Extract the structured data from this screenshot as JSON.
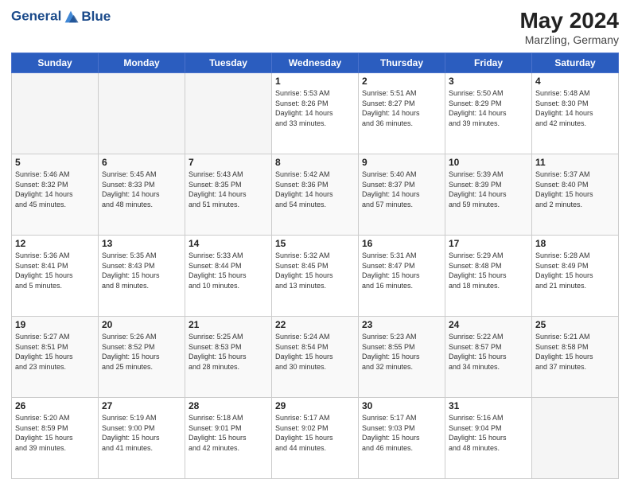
{
  "header": {
    "logo_line1": "General",
    "logo_line2": "Blue",
    "month_year": "May 2024",
    "location": "Marzling, Germany"
  },
  "weekdays": [
    "Sunday",
    "Monday",
    "Tuesday",
    "Wednesday",
    "Thursday",
    "Friday",
    "Saturday"
  ],
  "weeks": [
    [
      {
        "day": "",
        "info": ""
      },
      {
        "day": "",
        "info": ""
      },
      {
        "day": "",
        "info": ""
      },
      {
        "day": "1",
        "info": "Sunrise: 5:53 AM\nSunset: 8:26 PM\nDaylight: 14 hours\nand 33 minutes."
      },
      {
        "day": "2",
        "info": "Sunrise: 5:51 AM\nSunset: 8:27 PM\nDaylight: 14 hours\nand 36 minutes."
      },
      {
        "day": "3",
        "info": "Sunrise: 5:50 AM\nSunset: 8:29 PM\nDaylight: 14 hours\nand 39 minutes."
      },
      {
        "day": "4",
        "info": "Sunrise: 5:48 AM\nSunset: 8:30 PM\nDaylight: 14 hours\nand 42 minutes."
      }
    ],
    [
      {
        "day": "5",
        "info": "Sunrise: 5:46 AM\nSunset: 8:32 PM\nDaylight: 14 hours\nand 45 minutes."
      },
      {
        "day": "6",
        "info": "Sunrise: 5:45 AM\nSunset: 8:33 PM\nDaylight: 14 hours\nand 48 minutes."
      },
      {
        "day": "7",
        "info": "Sunrise: 5:43 AM\nSunset: 8:35 PM\nDaylight: 14 hours\nand 51 minutes."
      },
      {
        "day": "8",
        "info": "Sunrise: 5:42 AM\nSunset: 8:36 PM\nDaylight: 14 hours\nand 54 minutes."
      },
      {
        "day": "9",
        "info": "Sunrise: 5:40 AM\nSunset: 8:37 PM\nDaylight: 14 hours\nand 57 minutes."
      },
      {
        "day": "10",
        "info": "Sunrise: 5:39 AM\nSunset: 8:39 PM\nDaylight: 14 hours\nand 59 minutes."
      },
      {
        "day": "11",
        "info": "Sunrise: 5:37 AM\nSunset: 8:40 PM\nDaylight: 15 hours\nand 2 minutes."
      }
    ],
    [
      {
        "day": "12",
        "info": "Sunrise: 5:36 AM\nSunset: 8:41 PM\nDaylight: 15 hours\nand 5 minutes."
      },
      {
        "day": "13",
        "info": "Sunrise: 5:35 AM\nSunset: 8:43 PM\nDaylight: 15 hours\nand 8 minutes."
      },
      {
        "day": "14",
        "info": "Sunrise: 5:33 AM\nSunset: 8:44 PM\nDaylight: 15 hours\nand 10 minutes."
      },
      {
        "day": "15",
        "info": "Sunrise: 5:32 AM\nSunset: 8:45 PM\nDaylight: 15 hours\nand 13 minutes."
      },
      {
        "day": "16",
        "info": "Sunrise: 5:31 AM\nSunset: 8:47 PM\nDaylight: 15 hours\nand 16 minutes."
      },
      {
        "day": "17",
        "info": "Sunrise: 5:29 AM\nSunset: 8:48 PM\nDaylight: 15 hours\nand 18 minutes."
      },
      {
        "day": "18",
        "info": "Sunrise: 5:28 AM\nSunset: 8:49 PM\nDaylight: 15 hours\nand 21 minutes."
      }
    ],
    [
      {
        "day": "19",
        "info": "Sunrise: 5:27 AM\nSunset: 8:51 PM\nDaylight: 15 hours\nand 23 minutes."
      },
      {
        "day": "20",
        "info": "Sunrise: 5:26 AM\nSunset: 8:52 PM\nDaylight: 15 hours\nand 25 minutes."
      },
      {
        "day": "21",
        "info": "Sunrise: 5:25 AM\nSunset: 8:53 PM\nDaylight: 15 hours\nand 28 minutes."
      },
      {
        "day": "22",
        "info": "Sunrise: 5:24 AM\nSunset: 8:54 PM\nDaylight: 15 hours\nand 30 minutes."
      },
      {
        "day": "23",
        "info": "Sunrise: 5:23 AM\nSunset: 8:55 PM\nDaylight: 15 hours\nand 32 minutes."
      },
      {
        "day": "24",
        "info": "Sunrise: 5:22 AM\nSunset: 8:57 PM\nDaylight: 15 hours\nand 34 minutes."
      },
      {
        "day": "25",
        "info": "Sunrise: 5:21 AM\nSunset: 8:58 PM\nDaylight: 15 hours\nand 37 minutes."
      }
    ],
    [
      {
        "day": "26",
        "info": "Sunrise: 5:20 AM\nSunset: 8:59 PM\nDaylight: 15 hours\nand 39 minutes."
      },
      {
        "day": "27",
        "info": "Sunrise: 5:19 AM\nSunset: 9:00 PM\nDaylight: 15 hours\nand 41 minutes."
      },
      {
        "day": "28",
        "info": "Sunrise: 5:18 AM\nSunset: 9:01 PM\nDaylight: 15 hours\nand 42 minutes."
      },
      {
        "day": "29",
        "info": "Sunrise: 5:17 AM\nSunset: 9:02 PM\nDaylight: 15 hours\nand 44 minutes."
      },
      {
        "day": "30",
        "info": "Sunrise: 5:17 AM\nSunset: 9:03 PM\nDaylight: 15 hours\nand 46 minutes."
      },
      {
        "day": "31",
        "info": "Sunrise: 5:16 AM\nSunset: 9:04 PM\nDaylight: 15 hours\nand 48 minutes."
      },
      {
        "day": "",
        "info": ""
      }
    ]
  ]
}
